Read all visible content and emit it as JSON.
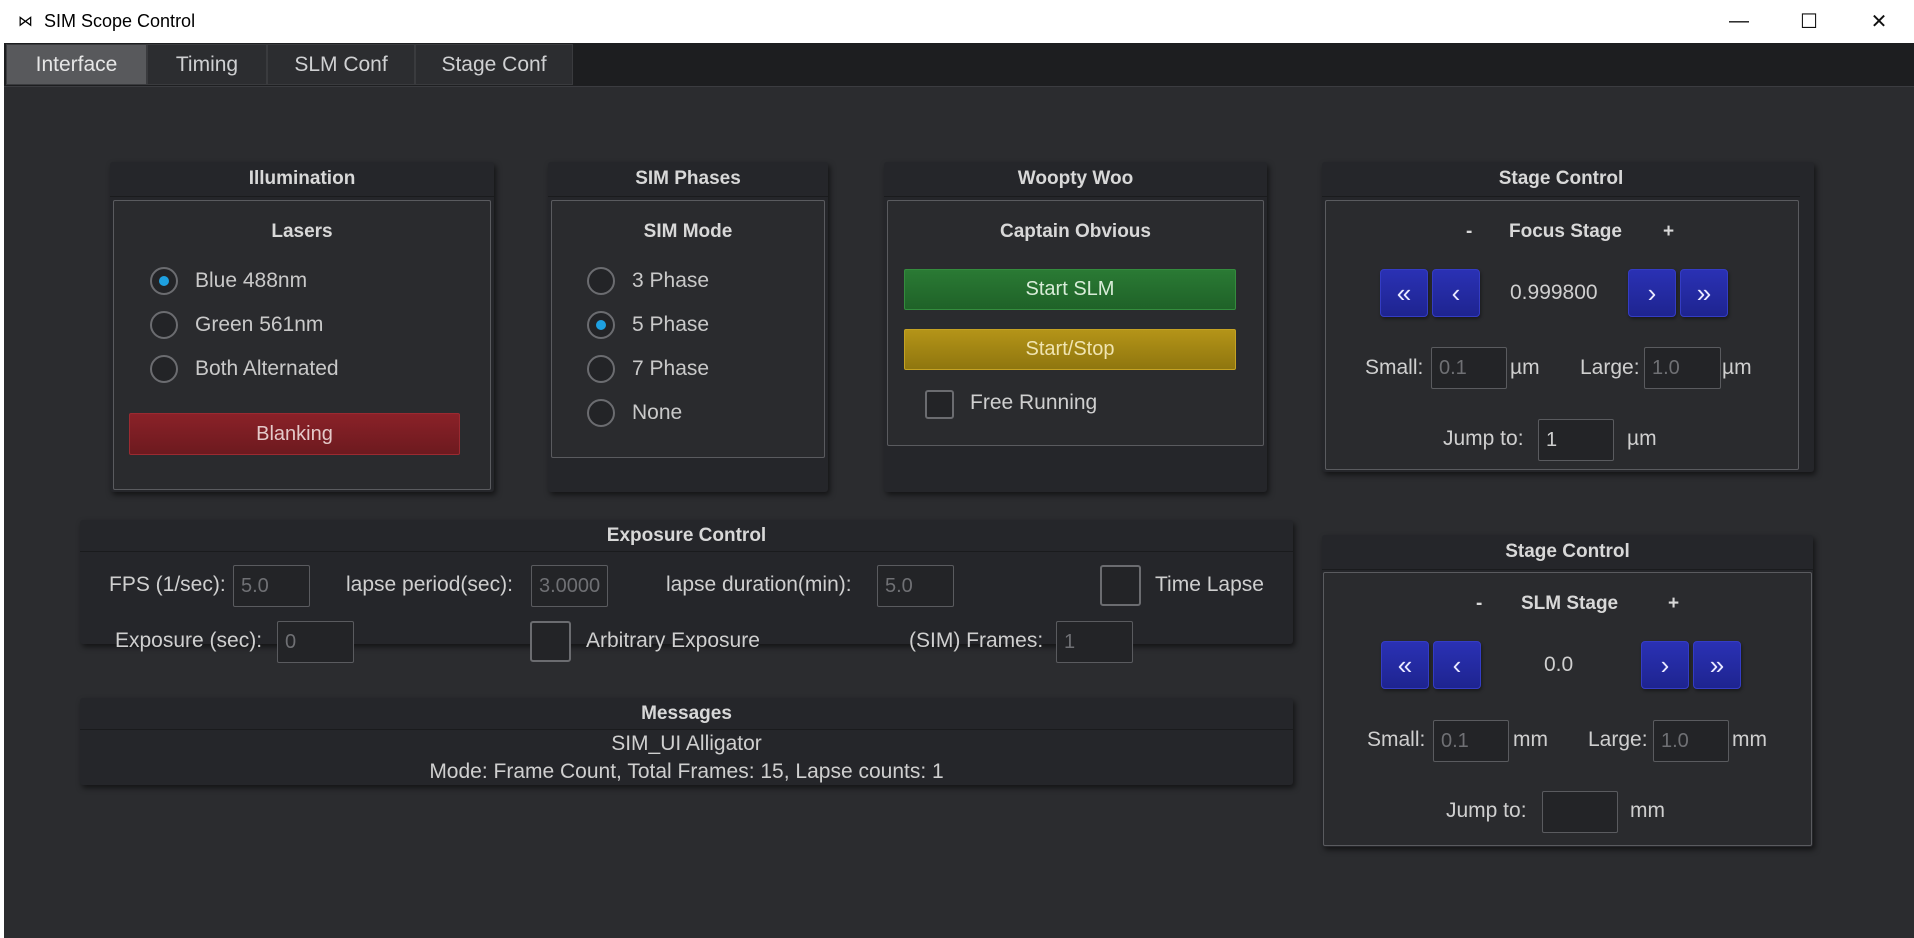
{
  "window": {
    "title": "SIM Scope Control",
    "icon": "bowtie-app-icon"
  },
  "tabs": [
    {
      "label": "Interface",
      "active": true
    },
    {
      "label": "Timing",
      "active": false
    },
    {
      "label": "SLM Conf",
      "active": false
    },
    {
      "label": "Stage Conf",
      "active": false
    }
  ],
  "illumination": {
    "title": "Illumination",
    "subtitle": "Lasers",
    "options": [
      {
        "label": "Blue 488nm",
        "checked": true
      },
      {
        "label": "Green 561nm",
        "checked": false
      },
      {
        "label": "Both Alternated",
        "checked": false
      }
    ],
    "blanking_label": "Blanking"
  },
  "sim_phases": {
    "title": "SIM Phases",
    "subtitle": "SIM Mode",
    "options": [
      {
        "label": "3 Phase",
        "checked": false
      },
      {
        "label": "5 Phase",
        "checked": true
      },
      {
        "label": "7 Phase",
        "checked": false
      },
      {
        "label": "None",
        "checked": false
      }
    ]
  },
  "woopty": {
    "title": "Woopty Woo",
    "subtitle": "Captain Obvious",
    "start_slm_label": "Start SLM",
    "start_stop_label": "Start/Stop",
    "free_running_label": "Free Running",
    "free_running_checked": false
  },
  "focus_stage": {
    "title": "Stage Control",
    "minus": "-",
    "stage_label": "Focus Stage",
    "plus": "+",
    "value": "0.999800",
    "small_label": "Small:",
    "small_value": "0.1",
    "small_unit": "µm",
    "large_label": "Large:",
    "large_value": "1.0",
    "large_unit": "µm",
    "jump_label": "Jump to:",
    "jump_value": "1",
    "jump_unit": "µm"
  },
  "slm_stage": {
    "title": "Stage Control",
    "minus": "-",
    "stage_label": "SLM Stage",
    "plus": "+",
    "value": "0.0",
    "small_label": "Small:",
    "small_value": "0.1",
    "small_unit": "mm",
    "large_label": "Large:",
    "large_value": "1.0",
    "large_unit": "mm",
    "jump_label": "Jump to:",
    "jump_value": "",
    "jump_unit": "mm"
  },
  "exposure": {
    "title": "Exposure Control",
    "fps_label": "FPS (1/sec):",
    "fps_value": "5.0",
    "lapse_period_label": "lapse period(sec):",
    "lapse_period_value": "3.0000",
    "lapse_duration_label": "lapse duration(min):",
    "lapse_duration_value": "5.0",
    "time_lapse_label": "Time Lapse",
    "exposure_label": "Exposure (sec):",
    "exposure_value": "0",
    "arbitrary_label": "Arbitrary Exposure",
    "frames_label": "(SIM) Frames:",
    "frames_value": "1"
  },
  "messages": {
    "title": "Messages",
    "line1": "SIM_UI Alligator",
    "line2": "Mode: Frame Count, Total Frames: 15, Lapse counts: 1"
  }
}
